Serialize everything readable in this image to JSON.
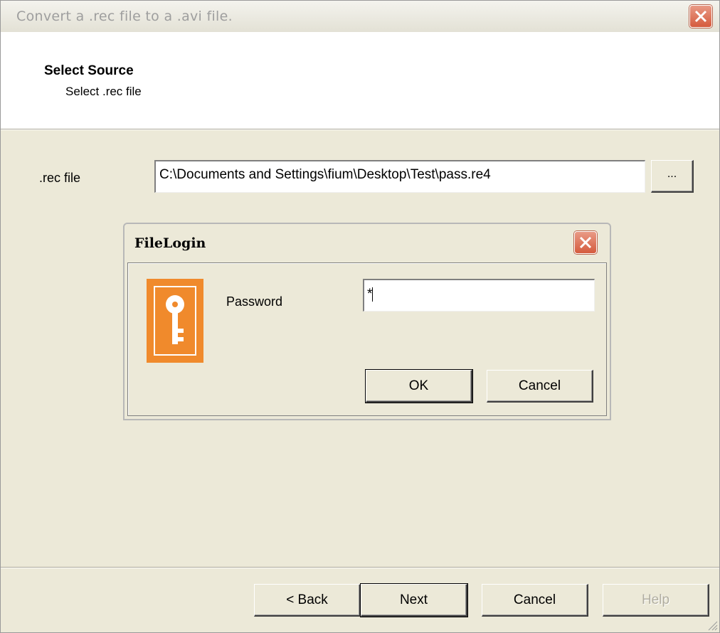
{
  "window": {
    "title": "Convert a .rec file to a .avi file."
  },
  "header": {
    "title": "Select Source",
    "subtitle": "Select .rec file"
  },
  "form": {
    "rec_label": ".rec file",
    "rec_value": "C:\\Documents and Settings\\fium\\Desktop\\Test\\pass.re4",
    "browse_label": "..."
  },
  "login_dialog": {
    "title": "FileLogin",
    "password_label": "Password",
    "password_value": "*",
    "ok_label": "OK",
    "cancel_label": "Cancel"
  },
  "footer": {
    "back_label": "< Back",
    "next_label": "Next",
    "cancel_label": "Cancel",
    "help_label": "Help"
  },
  "colors": {
    "key_icon": "#f08a2c",
    "close_button": "#d55b3e",
    "dialog_face": "#ece9d8"
  }
}
